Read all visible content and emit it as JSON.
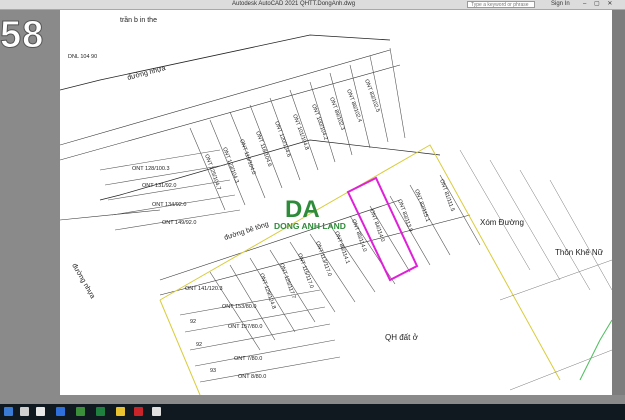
{
  "window": {
    "title": "Autodesk AutoCAD 2021   QHTT.DongAnh.dwg",
    "search_placeholder": "Type a keyword or phrase",
    "sign_in": "Sign In",
    "window_controls": "– ▢ ✕"
  },
  "overlay_text": "58",
  "logo": {
    "letters": "DA",
    "name": "DONG ANH LAND"
  },
  "map": {
    "streets": {
      "top_road_label": "trần b  in the",
      "road_top": "đường nhựa",
      "road_left": "đường nhựa",
      "road_concrete": "đường bê tông"
    },
    "areas": {
      "xom_duong": "Xóm Đường",
      "thon_khe_nu": "Thôn Khê Nữ",
      "qh_dat_o": "QH đất ở"
    },
    "corner_code": "DNL 104\n 90",
    "plots_upper": [
      "ONT 83/102.5",
      "ONT 86/102.4",
      "ONT 89/102.3",
      "ONT 100/104.2",
      "ONT 101/104.8",
      "ONT 120/104.6",
      "ONT 118/104.6",
      "ONT 116/104.0",
      "ONT 123/104.3",
      "ONT 125/104.7",
      "ONT 128/100.3",
      "ONT 131/92.0",
      "ONT 134/92.0",
      "ONT 149/92.0"
    ],
    "plots_lower": [
      "ONT 81/111.5",
      "ONT 82/115.1",
      "ONT 83/113.9",
      "ONT 84/114.0",
      "ONT 85/114.0",
      "ONT 86/114.1",
      "ONT 113/117.0",
      "ONT 115/117.0",
      "ONT 125/117.7",
      "ONT 141/120.3",
      "ONT 129/124.8",
      "ONT 153/80.0",
      "ONT 157/80.0",
      "ONT 7/80.0",
      "ONT 8/80.0",
      "92",
      "92",
      "93"
    ],
    "highlight_color": "#e020d8"
  }
}
